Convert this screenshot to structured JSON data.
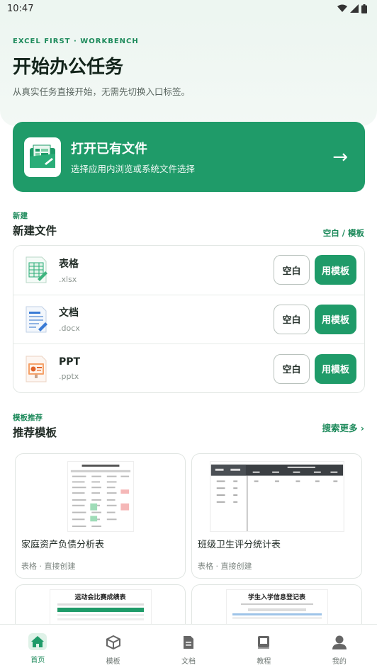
{
  "status": {
    "time": "10:47"
  },
  "hero": {
    "kicker": "EXCEL FIRST · WORKBENCH",
    "title": "开始办公任务",
    "subtitle": "从真实任务直接开始，无需先切换入口标签。"
  },
  "open_file": {
    "title": "打开已有文件",
    "subtitle": "选择应用内浏览或系统文件选择",
    "arrow": "→"
  },
  "new_section": {
    "kicker": "新建",
    "title": "新建文件",
    "link": "空白 / 模板",
    "items": [
      {
        "name": "表格",
        "ext": ".xlsx",
        "blank": "空白",
        "template": "用模板",
        "icon": "spreadsheet-icon"
      },
      {
        "name": "文档",
        "ext": ".docx",
        "blank": "空白",
        "template": "用模板",
        "icon": "document-icon"
      },
      {
        "name": "PPT",
        "ext": ".pptx",
        "blank": "空白",
        "template": "用模板",
        "icon": "presentation-icon"
      }
    ]
  },
  "template_section": {
    "kicker": "模板推荐",
    "title": "推荐模板",
    "link": "搜索更多 ›",
    "cards": [
      {
        "name": "家庭资产负债分析表",
        "meta": "表格 · 直接创建"
      },
      {
        "name": "班级卫生评分统计表",
        "meta": "表格 · 直接创建"
      },
      {
        "name": "运动会比赛成绩表",
        "meta": ""
      },
      {
        "name": "学生入学信息登记表",
        "meta": ""
      }
    ]
  },
  "nav": {
    "items": [
      {
        "label": "首页",
        "icon": "home-icon",
        "active": true
      },
      {
        "label": "模板",
        "icon": "cube-icon",
        "active": false
      },
      {
        "label": "文档",
        "icon": "document-icon",
        "active": false
      },
      {
        "label": "教程",
        "icon": "book-icon",
        "active": false
      },
      {
        "label": "我的",
        "icon": "profile-icon",
        "active": false
      }
    ]
  },
  "colors": {
    "accent": "#1f9b69",
    "accent_text": "#1d8a5b",
    "hero_bg": "#edf6f1"
  }
}
